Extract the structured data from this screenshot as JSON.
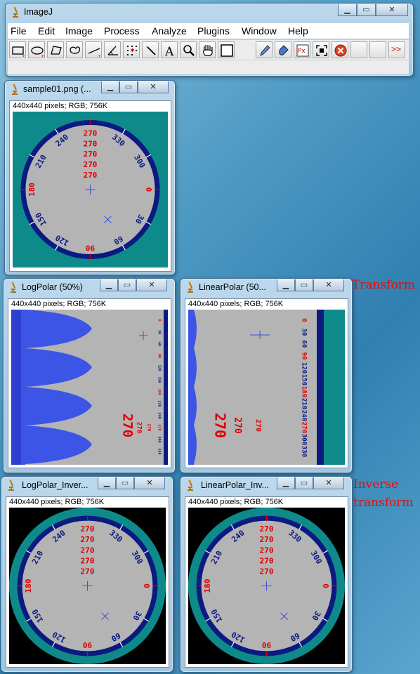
{
  "app": {
    "title": "ImageJ",
    "menu": [
      "File",
      "Edit",
      "Image",
      "Process",
      "Analyze",
      "Plugins",
      "Window",
      "Help"
    ],
    "tools": [
      "rectangle-icon",
      "oval-icon",
      "polygon-icon",
      "freehand-icon",
      "line-icon",
      "angle-icon",
      "point-icon",
      "wand-icon",
      "text-icon",
      "magnifier-icon",
      "hand-icon",
      "color-picker-icon",
      "pencil-icon",
      "dropper-icon",
      "pixel-inspector-icon",
      "roi-manager-icon",
      "close-circle-icon",
      "blank-tool",
      "blank-tool"
    ],
    "more_label": ">>"
  },
  "windows": {
    "sample": {
      "title": "sample01.png (...",
      "info": "440x440 pixels; RGB; 756K"
    },
    "logpolar": {
      "title": "LogPolar (50%)",
      "info": "440x440 pixels; RGB; 756K"
    },
    "linearpolar": {
      "title": "LinearPolar (50...",
      "info": "440x440 pixels; RGB; 756K"
    },
    "logpolar_inv": {
      "title": "LogPolar_Inver...",
      "info": "440x440 pixels; RGB; 756K"
    },
    "linearpolar_inv": {
      "title": "LinearPolar_Inv...",
      "info": "440x440 pixels; RGB; 756K"
    }
  },
  "annotations": {
    "transform": "Transform",
    "inverse_1": "Inverse",
    "inverse_2": "transform"
  },
  "dial": {
    "blue_labels": [
      "240",
      "330",
      "210",
      "300",
      "150",
      "30",
      "120",
      "60"
    ],
    "red_labels": [
      "270",
      "270",
      "270",
      "270",
      "270",
      "180",
      "0",
      "90"
    ]
  },
  "strip": {
    "big_label": "270",
    "tick_labels": [
      "0",
      "30",
      "60",
      "90",
      "120",
      "150",
      "180",
      "210",
      "240",
      "270",
      "300",
      "330"
    ]
  },
  "colors": {
    "teal": "#0e8a8a",
    "navy": "#0b1a80",
    "gray": "#b4b4b4",
    "red": "#e00000",
    "blue": "#3c55e6"
  }
}
